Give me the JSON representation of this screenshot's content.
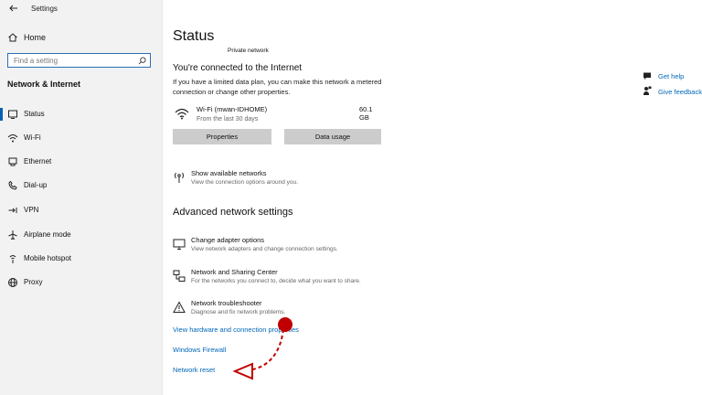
{
  "window": {
    "title": "Settings"
  },
  "sidebar": {
    "home_label": "Home",
    "search_placeholder": "Find a setting",
    "section_title": "Network & Internet",
    "items": [
      {
        "label": "Status",
        "icon": "globe-status-icon",
        "active": true
      },
      {
        "label": "Wi-Fi",
        "icon": "wifi-icon"
      },
      {
        "label": "Ethernet",
        "icon": "ethernet-icon"
      },
      {
        "label": "Dial-up",
        "icon": "dialup-icon"
      },
      {
        "label": "VPN",
        "icon": "vpn-icon"
      },
      {
        "label": "Airplane mode",
        "icon": "airplane-icon"
      },
      {
        "label": "Mobile hotspot",
        "icon": "hotspot-icon"
      },
      {
        "label": "Proxy",
        "icon": "proxy-globe-icon"
      }
    ]
  },
  "main": {
    "title": "Status",
    "network_type": "Private network",
    "connected_heading": "You're connected to the Internet",
    "connected_desc": "If you have a limited data plan, you can make this network a metered connection or change other properties.",
    "connection": {
      "name": "Wi-Fi (mwan-IDHOME)",
      "period": "From the last 30 days",
      "usage": "60.1 GB"
    },
    "buttons": {
      "properties": "Properties",
      "data_usage": "Data usage"
    },
    "show_networks": {
      "title": "Show available networks",
      "desc": "View the connection options around you."
    },
    "advanced_heading": "Advanced network settings",
    "adapter": {
      "title": "Change adapter options",
      "desc": "View network adapters and change connection settings."
    },
    "sharing": {
      "title": "Network and Sharing Center",
      "desc": "For the networks you connect to, decide what you want to share."
    },
    "troubleshooter": {
      "title": "Network troubleshooter",
      "desc": "Diagnose and fix network problems."
    },
    "links": {
      "hardware": "View hardware and connection properties",
      "firewall": "Windows Firewall",
      "reset": "Network reset"
    }
  },
  "help": {
    "get_help": "Get help",
    "give_feedback": "Give feedback"
  },
  "colors": {
    "accent": "#0063b1",
    "link": "#0067b8",
    "annotation": "#c00000"
  }
}
